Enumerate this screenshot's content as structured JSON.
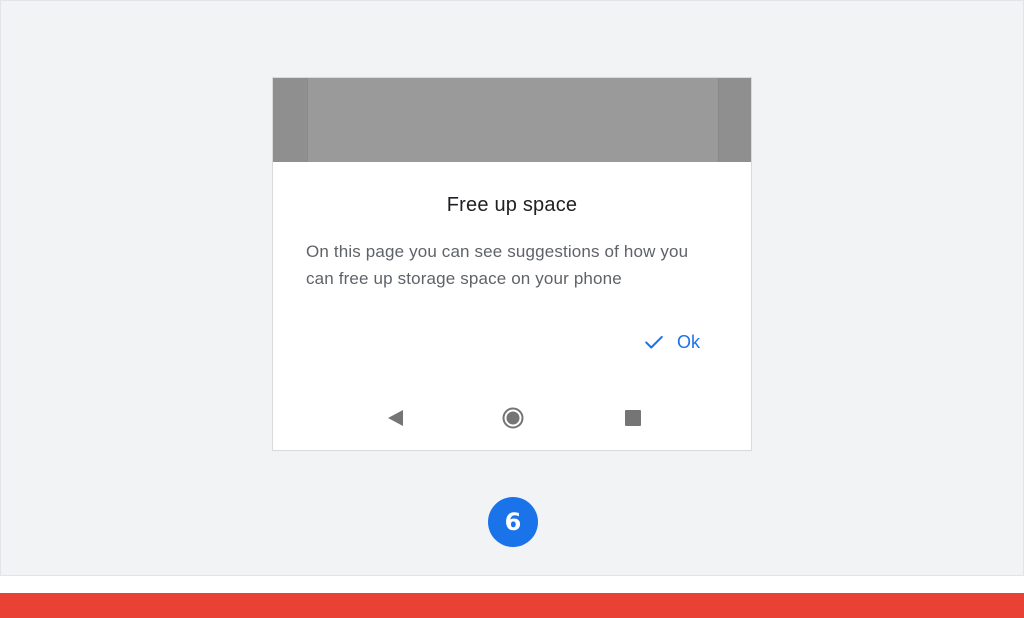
{
  "dialog": {
    "title": "Free up space",
    "body": "On this page you can see suggestions of how you can free up storage space on your phone",
    "ok_label": "Ok"
  },
  "navigation": {
    "back_icon": "back-triangle-icon",
    "home_icon": "home-circle-icon",
    "recents_icon": "recents-square-icon"
  },
  "step": {
    "number": "6"
  },
  "colors": {
    "accent": "#1a73e8",
    "footer": "#e94235",
    "background": "#f1f3f4",
    "scrim": "#9a9a9a"
  }
}
